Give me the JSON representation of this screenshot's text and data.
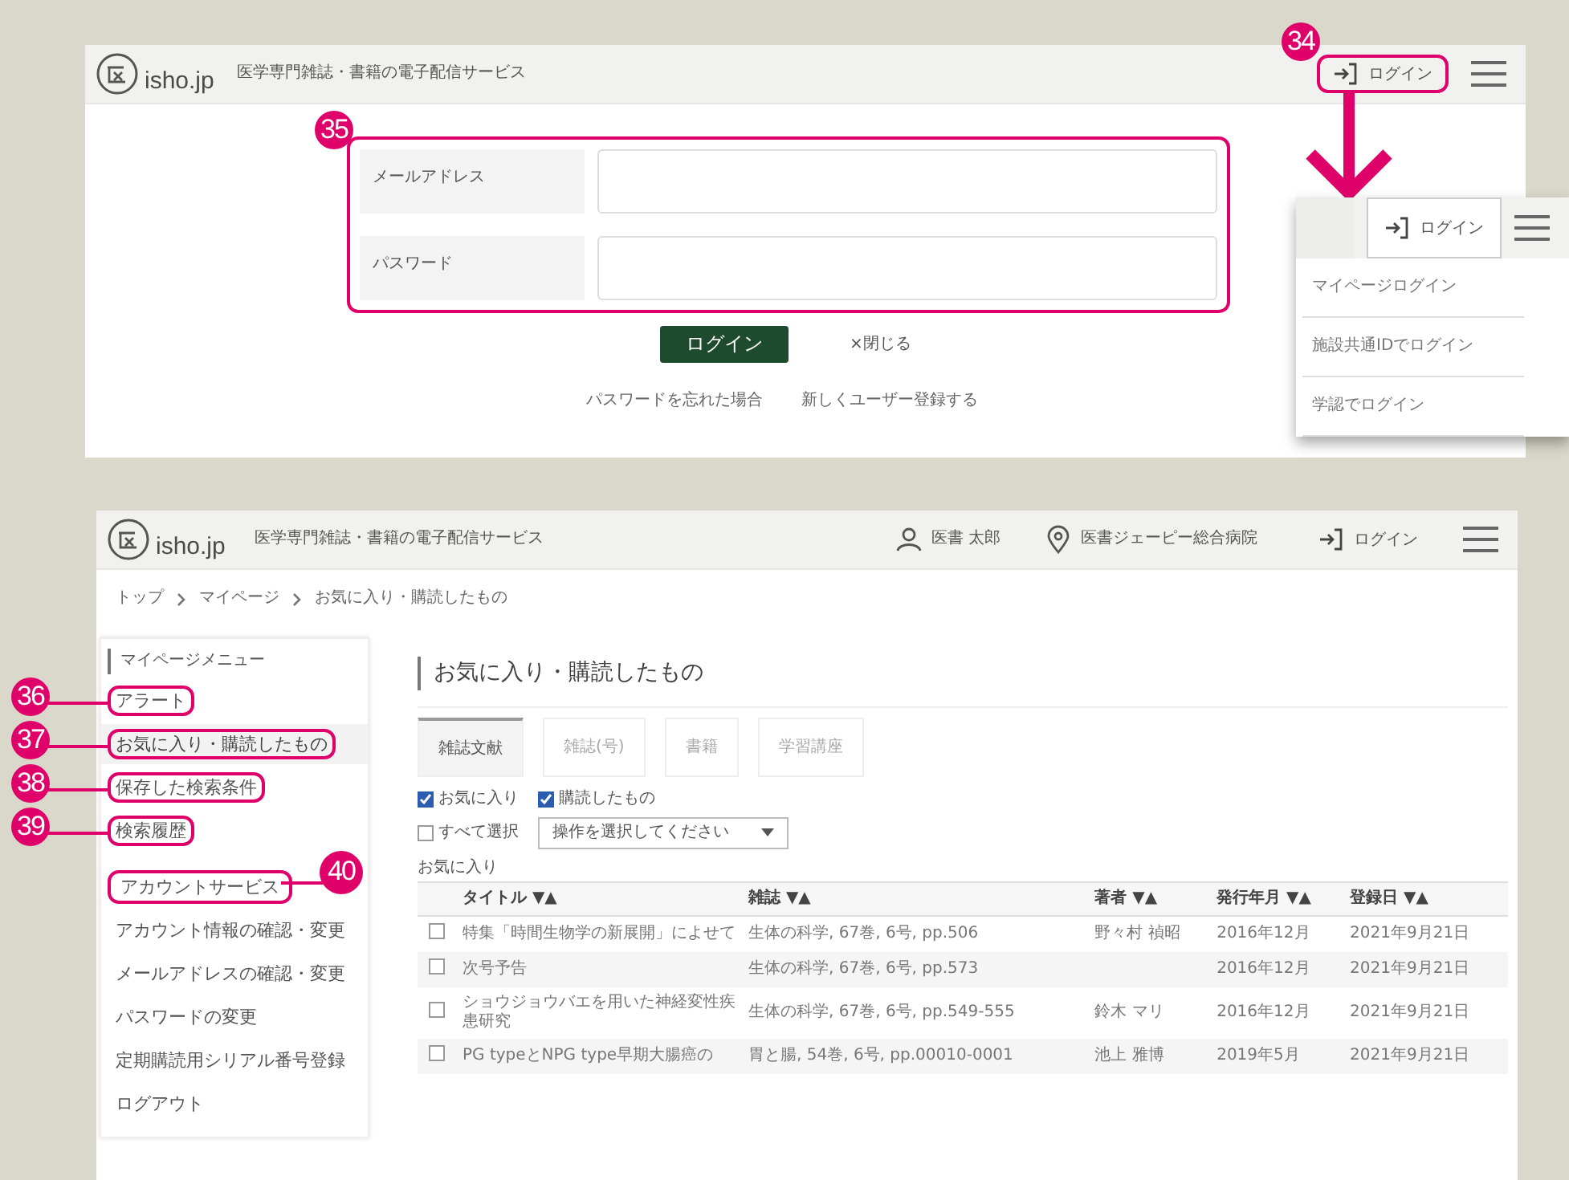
{
  "login_screen": {
    "logo": "isho.jp",
    "tagline": "医学専門雑誌・書籍の電子配信サービス",
    "header_login": {
      "label": "ログイン",
      "callout": "34"
    },
    "form": {
      "callout": "35",
      "fields": [
        {
          "label": "メールアドレス"
        },
        {
          "label": "パスワード"
        }
      ]
    },
    "submit": "ログイン",
    "close": "×閉じる",
    "links": [
      "パスワードを忘れた場合",
      "新しくユーザー登録する"
    ]
  },
  "login_menu": {
    "button": "ログイン",
    "items": [
      "マイページログイン",
      "施設共通IDでログイン",
      "学認でログイン"
    ]
  },
  "mypage_screen": {
    "logo": "isho.jp",
    "tagline": "医学専門雑誌・書籍の電子配信サービス",
    "user": "医書 太郎",
    "facility": "医書ジェーピー総合病院",
    "header_login": "ログイン",
    "breadcrumb": [
      "トップ",
      "マイページ",
      "お気に入り・購読したもの"
    ],
    "sidebar": [
      {
        "heading": "マイページメニュー",
        "items": [
          {
            "label": "アラート",
            "selected": false,
            "callout": "36"
          },
          {
            "label": "お気に入り・購読したもの",
            "selected": true,
            "callout": "37"
          },
          {
            "label": "保存した検索条件",
            "selected": false,
            "callout": "38"
          },
          {
            "label": "検索履歴",
            "selected": false,
            "callout": "39"
          }
        ]
      },
      {
        "heading": "アカウントサービス",
        "callout": "40",
        "items": [
          {
            "label": "アカウント情報の確認・変更",
            "selected": false
          },
          {
            "label": "メールアドレスの確認・変更",
            "selected": false
          },
          {
            "label": "パスワードの変更",
            "selected": false
          },
          {
            "label": "定期購読用シリアル番号登録",
            "selected": false
          },
          {
            "label": "ログアウト",
            "selected": false
          }
        ]
      }
    ],
    "title": "お気に入り・購読したもの",
    "tabs": [
      {
        "label": "雑誌文献",
        "selected": true
      },
      {
        "label": "雑誌(号)",
        "selected": false
      },
      {
        "label": "書籍",
        "selected": false
      },
      {
        "label": "学習講座",
        "selected": false
      }
    ],
    "filters": [
      {
        "label": "お気に入り",
        "checked": true
      },
      {
        "label": "購読したもの",
        "checked": true
      }
    ],
    "select_all": {
      "label": "すべて選択",
      "checked": false
    },
    "action_select": "操作を選択してください",
    "section": "お気に入り",
    "table": {
      "columns": [
        "タイトル ▼▲",
        "雑誌 ▼▲",
        "著者 ▼▲",
        "発行年月 ▼▲",
        "登録日 ▼▲"
      ],
      "rows": [
        {
          "checked": false,
          "cells": [
            "特集「時間生物学の新展開」によせて",
            "生体の科学, 67巻, 6号, pp.506",
            "野々村 禎昭",
            "2016年12月",
            "2021年9月21日"
          ]
        },
        {
          "checked": false,
          "cells": [
            "次号予告",
            "生体の科学, 67巻, 6号, pp.573",
            "",
            "2016年12月",
            "2021年9月21日"
          ]
        },
        {
          "checked": false,
          "cells": [
            "ショウジョウバエを用いた神経変性疾患研究",
            "生体の科学, 67巻, 6号, pp.549-555",
            "鈴木 マリ",
            "2016年12月",
            "2021年9月21日"
          ]
        },
        {
          "checked": false,
          "cells": [
            "PG typeとNPG type早期大腸癌の",
            "胃と腸, 54巻, 6号, pp.00010-0001",
            "池上 雅博",
            "2019年5月",
            "2021年9月21日"
          ]
        }
      ]
    }
  }
}
